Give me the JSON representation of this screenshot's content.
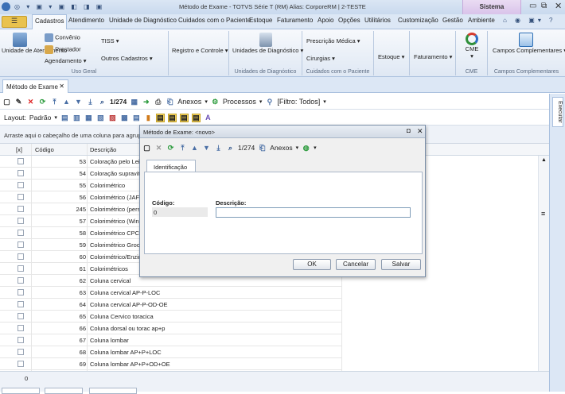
{
  "window": {
    "title": "Método de Exame - TOTVS Série T  (RM) Alias: CorporeRM | 2-TESTE",
    "system_badge": "Sistema"
  },
  "ribbon_tabs": [
    "Cadastros",
    "Atendimento",
    "Unidade de Diagnóstico",
    "Cuidados com o Paciente",
    "Estoque",
    "Faturamento",
    "Apoio",
    "Opções",
    "Utilitários",
    "Customização",
    "Gestão",
    "Ambiente"
  ],
  "ribbon": {
    "unidade_atendimento": "Unidade de Atendimento",
    "convenio": "Convênio",
    "prestador": "Prestador",
    "agendamento": "Agendamento",
    "tiss": "TISS",
    "outros_cadastros": "Outros Cadastros",
    "uso_geral": "Uso Geral",
    "registro_controle": "Registro e Controle",
    "unidades_diag": "Unidades de Diagnóstico",
    "unidade_diag_group": "Unidades de Diagnóstico",
    "prescricao_medica": "Prescrição Médica",
    "cirurgias": "Cirurgias",
    "cuidados_group": "Cuidados com o Paciente",
    "estoque": "Estoque",
    "faturamento": "Faturamento",
    "cme": "CME",
    "cme_group": "CME",
    "campos_complementares": "Campos Complementares",
    "campos_group": "Campos Complementares"
  },
  "doc_tab": "Método de Exame",
  "toolbar": {
    "record_pos": "1/274",
    "anexos": "Anexos",
    "processos": "Processos",
    "filtro": "[Filtro: Todos]"
  },
  "layout": {
    "label": "Layout:",
    "value": "Padrão"
  },
  "group_hint": "Arraste aqui o cabeçalho de uma coluna para agrupar por essa coluna",
  "grid_headers": {
    "check": "[x]",
    "codigo": "Código",
    "descricao": "Descrição"
  },
  "rows": [
    {
      "codigo": "53",
      "descricao": "Coloração pelo Leishman"
    },
    {
      "codigo": "54",
      "descricao": "Coloração supravital"
    },
    {
      "codigo": "55",
      "descricao": "Colorimétrico"
    },
    {
      "codigo": "56",
      "descricao": "Colorimétrico (JAFFE)"
    },
    {
      "codigo": "245",
      "descricao": "Colorimétrico (persulfato)"
    },
    {
      "codigo": "57",
      "descricao": "Colorimétrico (Winkler)"
    },
    {
      "codigo": "58",
      "descricao": "Colorimétrico CPC"
    },
    {
      "codigo": "59",
      "descricao": "Colorimétrico Grocott"
    },
    {
      "codigo": "60",
      "descricao": "Colorimétrico/Enzimático"
    },
    {
      "codigo": "61",
      "descricao": "Colorimétricos"
    },
    {
      "codigo": "62",
      "descricao": "Coluna cervical"
    },
    {
      "codigo": "63",
      "descricao": "Coluna cervical AP-P-LOC"
    },
    {
      "codigo": "64",
      "descricao": "Coluna cervical AP-P-OD-OE"
    },
    {
      "codigo": "65",
      "descricao": "Coluna Cervico toracica"
    },
    {
      "codigo": "66",
      "descricao": "Coluna dorsal ou torac ap+p"
    },
    {
      "codigo": "67",
      "descricao": "Coluna lombar"
    },
    {
      "codigo": "68",
      "descricao": "Coluna lombar AP+P+LOC"
    },
    {
      "codigo": "69",
      "descricao": "Coluna lombar AP+P+OD+OE"
    },
    {
      "codigo": "261",
      "descricao": "COLUNA OBLIQUA DIREITA E ESQUERDA"
    }
  ],
  "footer_count": "0",
  "side_tab": "Executar",
  "dialog": {
    "title": "Método de Exame: <novo>",
    "record_pos": "1/274",
    "anexos": "Anexos",
    "tab": "Identificação",
    "codigo_label": "Código:",
    "codigo_value": "0",
    "descricao_label": "Descrição:",
    "descricao_value": "",
    "ok": "OK",
    "cancelar": "Cancelar",
    "salvar": "Salvar"
  }
}
